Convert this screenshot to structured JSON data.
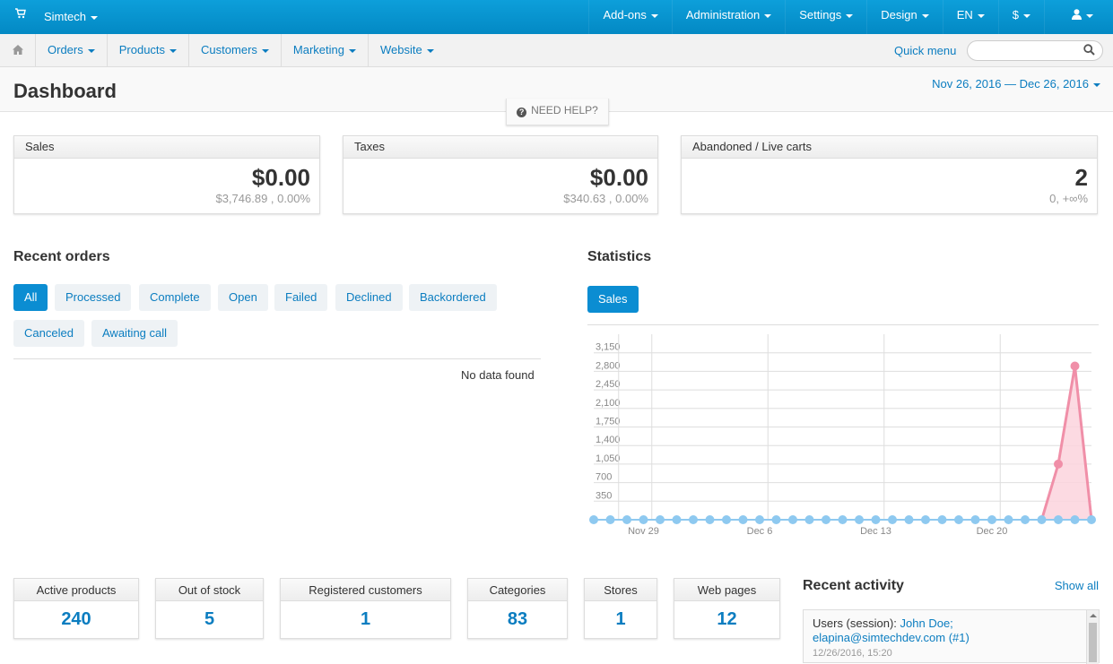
{
  "topbar": {
    "store": "Simtech",
    "nav": [
      "Add-ons",
      "Administration",
      "Settings",
      "Design",
      "EN",
      "$"
    ]
  },
  "navbar": {
    "menu": [
      "Orders",
      "Products",
      "Customers",
      "Marketing",
      "Website"
    ],
    "quick_menu": "Quick menu",
    "search_placeholder": ""
  },
  "header": {
    "title": "Dashboard",
    "date_range": "Nov 26, 2016 — Dec 26, 2016",
    "help": "NEED HELP?"
  },
  "cards": [
    {
      "title": "Sales",
      "value": "$0.00",
      "sub": "$3,746.89 , 0.00%"
    },
    {
      "title": "Taxes",
      "value": "$0.00",
      "sub": "$340.63 , 0.00%"
    },
    {
      "title": "Abandoned / Live carts",
      "value": "2",
      "sub": "0, +∞%"
    }
  ],
  "recent_orders": {
    "title": "Recent orders",
    "filters": [
      "All",
      "Processed",
      "Complete",
      "Open",
      "Failed",
      "Declined",
      "Backordered",
      "Canceled",
      "Awaiting call"
    ],
    "active_filter": "All",
    "empty": "No data found"
  },
  "statistics": {
    "title": "Statistics",
    "tab": "Sales"
  },
  "chart_data": {
    "type": "area",
    "ylim": [
      0,
      3500
    ],
    "y_ticks": [
      350,
      700,
      1050,
      1400,
      1750,
      2100,
      2450,
      2800,
      3150
    ],
    "y_tick_labels": [
      "350",
      "700",
      "1,050",
      "1,400",
      "1,750",
      "2,100",
      "2,450",
      "2,800",
      "3,150"
    ],
    "x_tick_labels": [
      "Nov 29",
      "Dec 6",
      "Dec 13",
      "Dec 20"
    ],
    "x_tick_indices": [
      3,
      10,
      17,
      24
    ],
    "series": [
      {
        "color": "#f4a0b5",
        "values": [
          0,
          0,
          0,
          0,
          0,
          0,
          0,
          0,
          0,
          0,
          0,
          0,
          0,
          0,
          0,
          0,
          0,
          0,
          0,
          0,
          0,
          0,
          0,
          0,
          0,
          0,
          0,
          0,
          0,
          0,
          0
        ]
      },
      {
        "color": "#f08fa8",
        "values": [
          null,
          null,
          null,
          null,
          null,
          null,
          null,
          null,
          null,
          null,
          null,
          null,
          null,
          null,
          null,
          null,
          null,
          null,
          null,
          null,
          null,
          null,
          null,
          null,
          null,
          null,
          null,
          0,
          1050,
          2900,
          0
        ]
      }
    ]
  },
  "stats": [
    {
      "label": "Active products",
      "value": "240"
    },
    {
      "label": "Out of stock",
      "value": "5"
    },
    {
      "label": "Registered customers",
      "value": "1"
    },
    {
      "label": "Categories",
      "value": "83"
    },
    {
      "label": "Stores",
      "value": "1"
    },
    {
      "label": "Web pages",
      "value": "12"
    }
  ],
  "recent_activity": {
    "title": "Recent activity",
    "show_all": "Show all",
    "item_prefix": "Users (session): ",
    "item_link1": "John Doe;",
    "item_link2": "elapina@simtechdev.com (#1)",
    "item_time": "12/26/2016, 15:20"
  },
  "colors": {
    "accent": "#0b8dd2",
    "link": "#0b7dc0",
    "chart_line": "#f08fa8",
    "chart_zero": "#8ec9f0"
  }
}
